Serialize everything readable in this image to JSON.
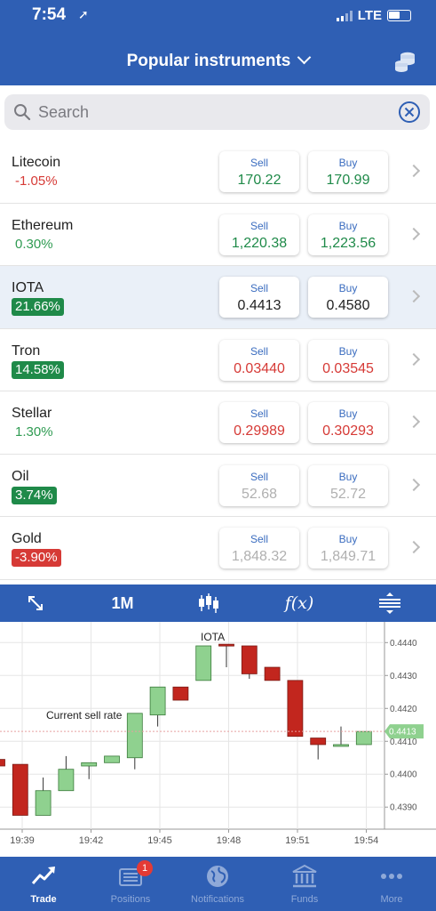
{
  "status": {
    "time": "7:54",
    "network": "LTE"
  },
  "header": {
    "title": "Popular instruments"
  },
  "search": {
    "placeholder": "Search"
  },
  "instruments": [
    {
      "name": "Litecoin",
      "change": "-1.05%",
      "sell_label": "Sell",
      "sell": "170.22",
      "buy_label": "Buy",
      "buy": "170.99"
    },
    {
      "name": "Ethereum",
      "change": "0.30%",
      "sell_label": "Sell",
      "sell": "1,220.38",
      "buy_label": "Buy",
      "buy": "1,223.56"
    },
    {
      "name": "IOTA",
      "change": "21.66%",
      "sell_label": "Sell",
      "sell": "0.4413",
      "buy_label": "Buy",
      "buy": "0.4580"
    },
    {
      "name": "Tron",
      "change": "14.58%",
      "sell_label": "Sell",
      "sell": "0.03440",
      "buy_label": "Buy",
      "buy": "0.03545"
    },
    {
      "name": "Stellar",
      "change": "1.30%",
      "sell_label": "Sell",
      "sell": "0.29989",
      "buy_label": "Buy",
      "buy": "0.30293"
    },
    {
      "name": "Oil",
      "change": "3.74%",
      "sell_label": "Sell",
      "sell": "52.68",
      "buy_label": "Buy",
      "buy": "52.72"
    },
    {
      "name": "Gold",
      "change": "-3.90%",
      "sell_label": "Sell",
      "sell": "1,848.32",
      "buy_label": "Buy",
      "buy": "1,849.71"
    }
  ],
  "chart_toolbar": {
    "period": "1M",
    "indicator": "f(x)"
  },
  "chart_data": {
    "type": "candlestick",
    "instrument_label": "IOTA",
    "annotation": "Current sell rate",
    "current_sell_rate": "0.4413",
    "y_ticks": [
      "0.4440",
      "0.4430",
      "0.4420",
      "0.4410",
      "0.4400",
      "0.4390"
    ],
    "ylim": [
      0.43833,
      0.44463
    ],
    "x_ticks": [
      "19:39",
      "19:42",
      "19:45",
      "19:48",
      "19:51",
      "19:54"
    ],
    "candles": [
      {
        "open": 0.44045,
        "close": 0.44025,
        "high": 0.44045,
        "low": 0.44025
      },
      {
        "open": 0.4403,
        "close": 0.43875,
        "high": 0.4403,
        "low": 0.43875
      },
      {
        "open": 0.43875,
        "close": 0.4395,
        "high": 0.4399,
        "low": 0.43875
      },
      {
        "open": 0.4395,
        "close": 0.44015,
        "high": 0.44055,
        "low": 0.4395
      },
      {
        "open": 0.44025,
        "close": 0.44035,
        "high": 0.44035,
        "low": 0.43985
      },
      {
        "open": 0.44035,
        "close": 0.44055,
        "high": 0.44055,
        "low": 0.44035
      },
      {
        "open": 0.4405,
        "close": 0.44185,
        "high": 0.44185,
        "low": 0.44015
      },
      {
        "open": 0.4418,
        "close": 0.44265,
        "high": 0.44265,
        "low": 0.44145
      },
      {
        "open": 0.44265,
        "close": 0.44225,
        "high": 0.44265,
        "low": 0.44225
      },
      {
        "open": 0.44285,
        "close": 0.4439,
        "high": 0.4439,
        "low": 0.44285
      },
      {
        "open": 0.44395,
        "close": 0.4439,
        "high": 0.44395,
        "low": 0.44325
      },
      {
        "open": 0.4439,
        "close": 0.44305,
        "high": 0.4439,
        "low": 0.4429
      },
      {
        "open": 0.44325,
        "close": 0.44285,
        "high": 0.44325,
        "low": 0.44285
      },
      {
        "open": 0.44285,
        "close": 0.44115,
        "high": 0.44285,
        "low": 0.44115
      },
      {
        "open": 0.4411,
        "close": 0.4409,
        "high": 0.4411,
        "low": 0.44045
      },
      {
        "open": 0.4409,
        "close": 0.4409,
        "high": 0.44145,
        "low": 0.4409
      },
      {
        "open": 0.4409,
        "close": 0.4413,
        "high": 0.4413,
        "low": 0.4409
      }
    ]
  },
  "tabs": [
    {
      "label": "Trade",
      "icon": "trend-up-icon",
      "active": true
    },
    {
      "label": "Positions",
      "icon": "list-icon",
      "badge": "1"
    },
    {
      "label": "Notifications",
      "icon": "globe-icon"
    },
    {
      "label": "Funds",
      "icon": "bank-icon"
    },
    {
      "label": "More",
      "icon": "ellipsis-icon"
    }
  ],
  "colors": {
    "brand": "#2f5fb4",
    "up": "#1f8a49",
    "down": "#d63a36",
    "candle_up": "#8fd18f",
    "candle_down": "#c2261e"
  }
}
